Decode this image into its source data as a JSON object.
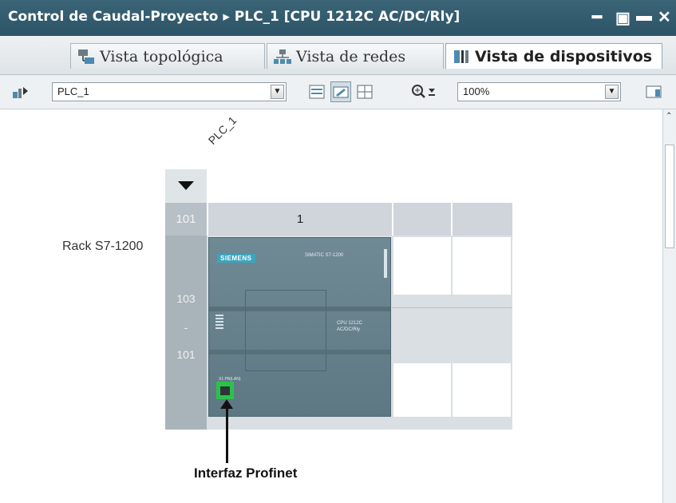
{
  "window": {
    "title": "Control de Caudal-Proyecto  ▸  PLC_1 [CPU 1212C AC/DC/Rly]",
    "controls": [
      "minimize",
      "restore",
      "maximize",
      "close"
    ]
  },
  "tabs": [
    {
      "label": "Vista topológica",
      "icon": "topology-icon",
      "active": false
    },
    {
      "label": "Vista de redes",
      "icon": "network-icon",
      "active": false
    },
    {
      "label": "Vista de dispositivos",
      "icon": "devices-icon",
      "active": true
    }
  ],
  "toolbar": {
    "device_select": "PLC_1",
    "zoom_select": "100%",
    "icons": [
      "device-list-icon",
      "device-overview-icon",
      "hardware-view-icon",
      "table-icon",
      "zoom-icon",
      "split-view-icon"
    ]
  },
  "canvas": {
    "device_label": "PLC_1",
    "rack_label": "Rack S7-1200",
    "slot_header_rows": [
      "101",
      "1",
      "",
      ""
    ],
    "row_numbers": [
      "103",
      "-",
      "101"
    ],
    "module": {
      "brand": "SIEMENS",
      "model": "SIMATIC S7-1200",
      "cpu_text_line1": "CPU 1212C",
      "cpu_text_line2": "AC/DC/Rly",
      "port_label": "X1 PN(LAN)"
    },
    "annotation": "Interfaz Profinet"
  },
  "colors": {
    "titlebar": "#2f5a6c",
    "module": "#66808b",
    "profinet_port": "#2cc24a"
  }
}
